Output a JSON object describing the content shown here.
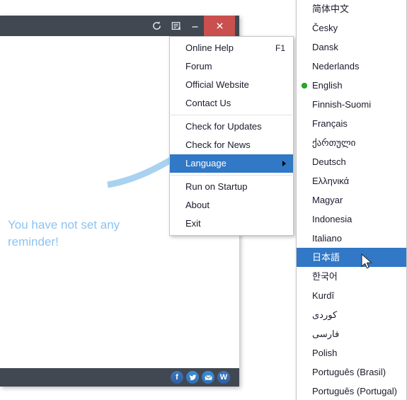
{
  "window": {
    "titlebar": {
      "buttons": [
        {
          "name": "refresh",
          "glyph": "↺",
          "label": "Refresh"
        },
        {
          "name": "note",
          "glyph": "▤",
          "label": "Notes"
        },
        {
          "name": "minimize",
          "glyph": "–",
          "label": "Minimize"
        },
        {
          "name": "close",
          "glyph": "✕",
          "label": "Close"
        }
      ],
      "close_color": "#c9504e",
      "bar_color": "#414852"
    },
    "content": {
      "empty_message": "You have not set any reminder!",
      "empty_message_color": "#8cc3f2",
      "arc_color": "#a8d2f0"
    },
    "bottombar": {
      "social": [
        {
          "name": "facebook",
          "glyph": "f",
          "label": "Facebook"
        },
        {
          "name": "twitter",
          "glyph": "❦",
          "label": "Twitter"
        },
        {
          "name": "email",
          "glyph": "✉",
          "label": "Email"
        },
        {
          "name": "weibo",
          "glyph": "W",
          "label": "Weibo"
        }
      ]
    }
  },
  "context_menu": {
    "items": [
      {
        "label": "Online Help",
        "shortcut": "F1",
        "selected": false,
        "submenu": false
      },
      {
        "label": "Forum",
        "shortcut": "",
        "selected": false,
        "submenu": false
      },
      {
        "label": "Official Website",
        "shortcut": "",
        "selected": false,
        "submenu": false
      },
      {
        "label": "Contact Us",
        "shortcut": "",
        "selected": false,
        "submenu": false
      },
      {
        "separator": true
      },
      {
        "label": "Check for Updates",
        "shortcut": "",
        "selected": false,
        "submenu": false
      },
      {
        "label": "Check for News",
        "shortcut": "",
        "selected": false,
        "submenu": false
      },
      {
        "label": "Language",
        "shortcut": "",
        "selected": true,
        "submenu": true
      },
      {
        "separator": true
      },
      {
        "label": "Run on Startup",
        "shortcut": "",
        "selected": false,
        "submenu": false
      },
      {
        "label": "About",
        "shortcut": "",
        "selected": false,
        "submenu": false
      },
      {
        "label": "Exit",
        "shortcut": "",
        "selected": false,
        "submenu": false
      }
    ],
    "highlight_color": "#3178c6"
  },
  "language_menu": {
    "highlight_color": "#3178c6",
    "active_marker_color": "#22b022",
    "items": [
      {
        "label": "简体中文",
        "active": false,
        "selected": false
      },
      {
        "label": "Česky",
        "active": false,
        "selected": false
      },
      {
        "label": "Dansk",
        "active": false,
        "selected": false
      },
      {
        "label": "Nederlands",
        "active": false,
        "selected": false
      },
      {
        "label": "English",
        "active": true,
        "selected": false
      },
      {
        "label": "Finnish-Suomi",
        "active": false,
        "selected": false
      },
      {
        "label": "Français",
        "active": false,
        "selected": false
      },
      {
        "label": "ქართული",
        "active": false,
        "selected": false
      },
      {
        "label": "Deutsch",
        "active": false,
        "selected": false
      },
      {
        "label": "Ελληνικά",
        "active": false,
        "selected": false
      },
      {
        "label": "Magyar",
        "active": false,
        "selected": false
      },
      {
        "label": "Indonesia",
        "active": false,
        "selected": false
      },
      {
        "label": "Italiano",
        "active": false,
        "selected": false
      },
      {
        "label": "日本語",
        "active": false,
        "selected": true
      },
      {
        "label": "한국어",
        "active": false,
        "selected": false
      },
      {
        "label": "Kurdî",
        "active": false,
        "selected": false
      },
      {
        "label": "کوردی",
        "active": false,
        "selected": false
      },
      {
        "label": "فارسی",
        "active": false,
        "selected": false
      },
      {
        "label": "Polish",
        "active": false,
        "selected": false
      },
      {
        "label": "Português (Brasil)",
        "active": false,
        "selected": false
      },
      {
        "label": "Português (Portugal)",
        "active": false,
        "selected": false
      }
    ]
  }
}
